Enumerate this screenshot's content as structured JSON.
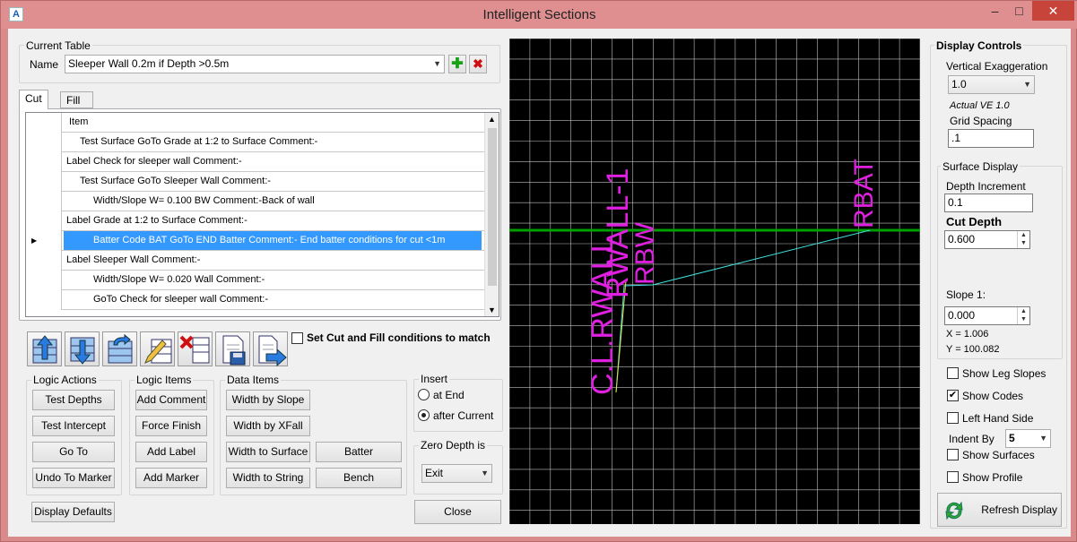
{
  "window": {
    "title": "Intelligent Sections",
    "close_glyph": "✕",
    "min_glyph": "–",
    "max_glyph": "□",
    "app_icon": "A"
  },
  "current_table": {
    "group_label": "Current Table",
    "name_label": "Name",
    "name_value": "Sleeper Wall 0.2m if Depth >0.5m",
    "add_icon": "plus-icon",
    "delete_icon": "x-icon"
  },
  "tabs": [
    {
      "label": "Cut"
    },
    {
      "label": "Fill"
    }
  ],
  "table": {
    "header": "Item",
    "rows": [
      {
        "text": "Test Surface GoTo Grade at 1:2 to Surface Comment:-",
        "indent": 1
      },
      {
        "text": "Label Check for sleeper wall Comment:-",
        "indent": 0
      },
      {
        "text": "Test Surface GoTo Sleeper Wall Comment:-",
        "indent": 1
      },
      {
        "text": "Width/Slope W= 0.100 BW Comment:-Back of wall",
        "indent": 2
      },
      {
        "text": "Label Grade at 1:2 to Surface Comment:-",
        "indent": 0
      },
      {
        "text": "Batter Code BAT GoTo END Batter Comment:- End batter conditions for cut <1m",
        "indent": 2,
        "selected": true
      },
      {
        "text": "Label Sleeper Wall Comment:-",
        "indent": 0
      },
      {
        "text": "Width/Slope W= 0.020 Wall Comment:-",
        "indent": 2
      },
      {
        "text": "GoTo Check for sleeper wall    Comment:-",
        "indent": 2
      }
    ],
    "selected_marker": "▶"
  },
  "toolbar": {
    "set_match_label": "Set Cut and Fill conditions to match",
    "set_match_checked": false
  },
  "logic_actions": {
    "label": "Logic Actions",
    "buttons": [
      "Test Depths",
      "Test Intercept",
      "Go To",
      "Undo To Marker"
    ]
  },
  "logic_items": {
    "label": "Logic Items",
    "buttons": [
      "Add Comment",
      "Force Finish",
      "Add Label",
      "Add Marker"
    ]
  },
  "data_items": {
    "label": "Data Items",
    "buttons": [
      "Width by Slope",
      "Width by XFall",
      "Width to Surface",
      "Width to String",
      "Batter",
      "Bench"
    ]
  },
  "insert": {
    "label": "Insert",
    "options": [
      "at End",
      "after Current"
    ],
    "selected": 1
  },
  "zero_depth": {
    "label": "Zero Depth is",
    "value": "Exit"
  },
  "display_defaults_label": "Display Defaults",
  "close_label": "Close",
  "canvas": {
    "labels": [
      "C.L.RWALL",
      "RWALL-1",
      "RBW",
      "RBAT"
    ],
    "label_color": "#e020e0",
    "surface_color": "#00a000",
    "section_color": "#40e0e0",
    "wall_color": "#e0e040"
  },
  "display_controls": {
    "title": "Display Controls",
    "ve_label": "Vertical Exaggeration",
    "ve_value": "1.0",
    "actual_ve": "Actual VE 1.0",
    "grid_label": "Grid Spacing",
    "grid_value": ".1",
    "surface_display_label": "Surface Display",
    "depth_inc_label": "Depth Increment",
    "depth_inc_value": "0.1",
    "cut_depth_label": "Cut Depth",
    "cut_depth_value": "0.600",
    "slope_label": "Slope 1:",
    "slope_value": "0.000",
    "x_readout": "X = 1.006",
    "y_readout": "Y = 100.082",
    "checks": [
      {
        "label": "Show Leg Slopes",
        "checked": false
      },
      {
        "label": "Show Codes",
        "checked": true
      },
      {
        "label": "Left Hand Side",
        "checked": false
      }
    ],
    "indent_label": "Indent By",
    "indent_value": "5",
    "checks2": [
      {
        "label": "Show Surfaces",
        "checked": false
      },
      {
        "label": "Show Profile",
        "checked": false
      }
    ],
    "refresh_label": "Refresh Display",
    "check_glyph": "✔"
  }
}
